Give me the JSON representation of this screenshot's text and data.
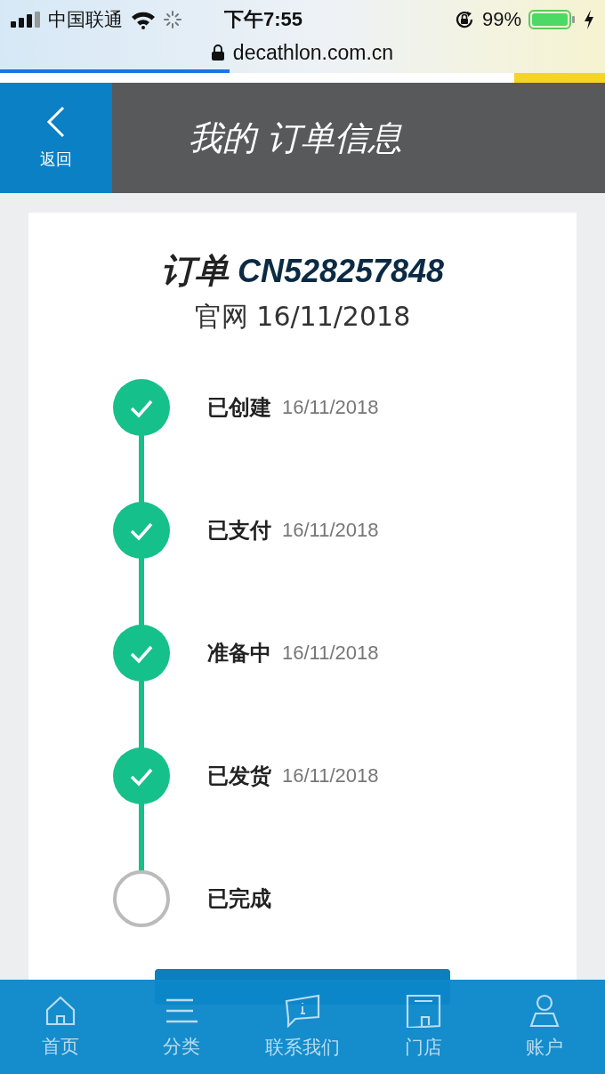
{
  "status_bar": {
    "carrier": "中国联通",
    "time": "下午7:55",
    "battery": "99%"
  },
  "browser": {
    "url": "decathlon.com.cn",
    "load_progress": {
      "level": 0.38
    }
  },
  "header": {
    "back_label": "返回",
    "title": "我的 订单信息"
  },
  "order": {
    "label": "订单",
    "number": "CN528257848",
    "source": "官网 16/11/2018"
  },
  "steps": [
    {
      "label": "已创建",
      "date": "16/11/2018",
      "done": true
    },
    {
      "label": "已支付",
      "date": "16/11/2018",
      "done": true
    },
    {
      "label": "准备中",
      "date": "16/11/2018",
      "done": true
    },
    {
      "label": "已发货",
      "date": "16/11/2018",
      "done": true
    },
    {
      "label": "已完成",
      "done": false
    }
  ],
  "nav": [
    {
      "kind": "home",
      "label": "首页"
    },
    {
      "kind": "menu",
      "label": "分类"
    },
    {
      "kind": "chat",
      "label": "联系我们"
    },
    {
      "kind": "store",
      "label": "门店"
    },
    {
      "kind": "user",
      "label": "账户"
    }
  ]
}
